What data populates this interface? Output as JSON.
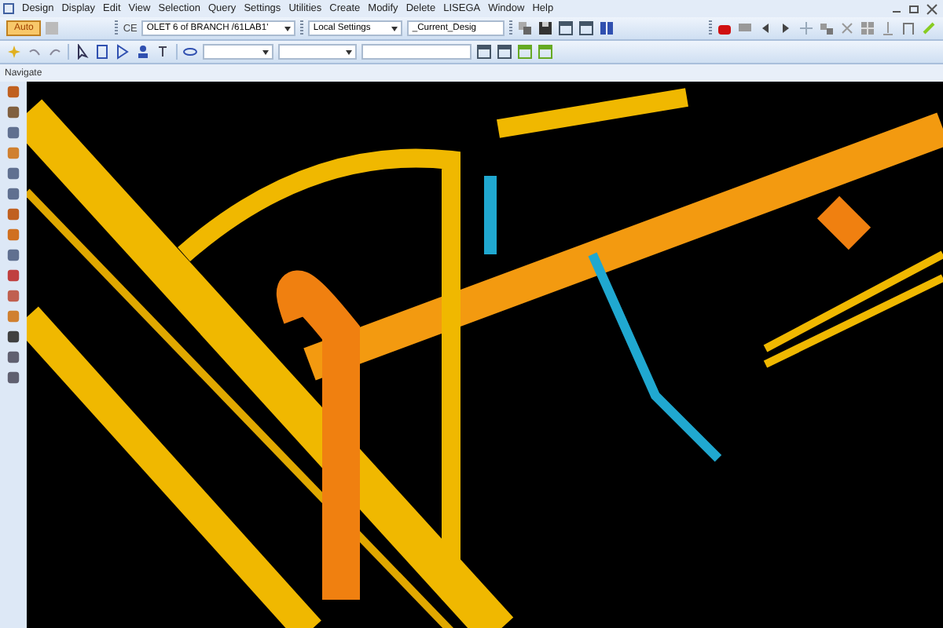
{
  "menu": [
    "Design",
    "Display",
    "Edit",
    "View",
    "Selection",
    "Query",
    "Settings",
    "Utilities",
    "Create",
    "Modify",
    "Delete",
    "LISEGA",
    "Window",
    "Help"
  ],
  "toolbar": {
    "auto_button": "Auto",
    "ce_label": "CE",
    "element_dropdown": "OLET 6 of BRANCH /61LAB1'",
    "settings_dropdown": "Local Settings",
    "design_dropdown": "_Current_Desig"
  },
  "navigate_panel": {
    "title": "Navigate"
  }
}
